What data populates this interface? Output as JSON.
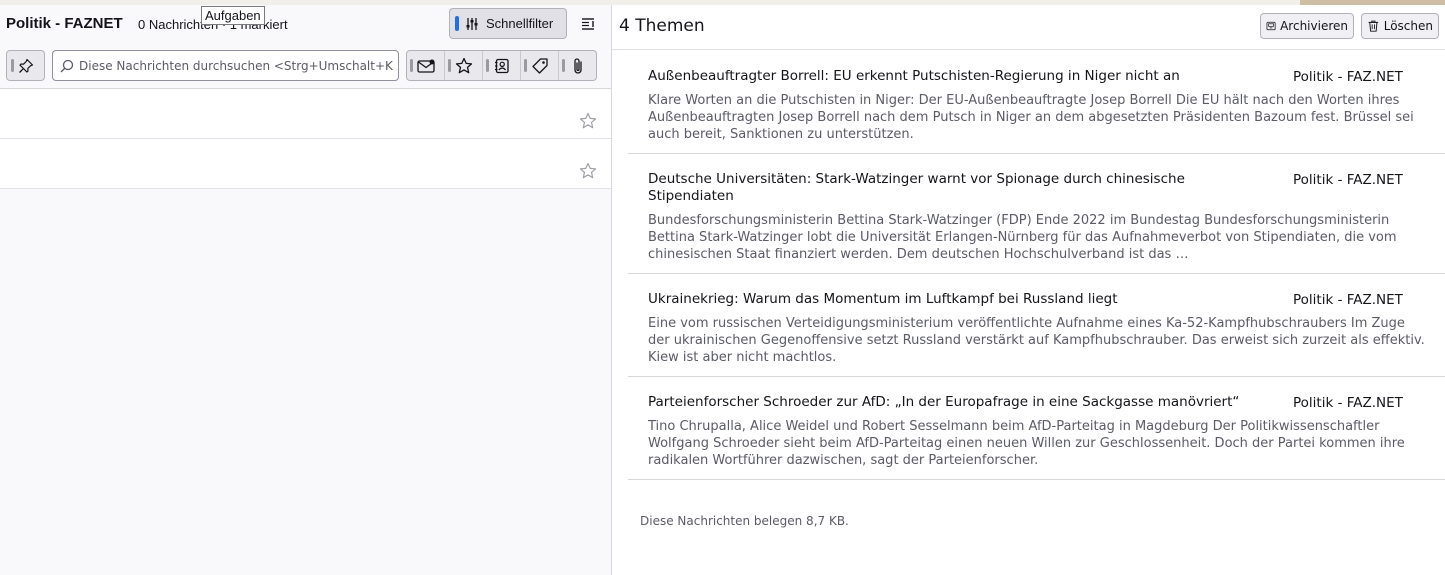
{
  "message_list": {
    "folder_name": "Politik - FAZNET",
    "count_text": "0 Nachrichten · 1 markiert",
    "tooltip": "Aufgaben",
    "quick_filter_label": "Schnellfilter",
    "search_placeholder": "Diese Nachrichten durchsuchen <Strg+Umschalt+K>",
    "filter_buttons": [
      "pin",
      "unread",
      "starred",
      "contact",
      "tags",
      "attachment"
    ],
    "rows": [
      {
        "starred": false
      },
      {
        "starred": false
      }
    ]
  },
  "summary": {
    "title": "4 Themen",
    "archive_label": "Archivieren",
    "delete_label": "Löschen",
    "topics": [
      {
        "title": "Außenbeauftragter Borrell: EU erkennt Putschisten-Regierung in Niger nicht an",
        "source": "Politik - FAZ.NET",
        "summary": "Klare Worten an die Putschisten in Niger: Der EU-Außenbeauftragte Josep Borrell Die EU hält nach den Worten ihres Außenbeauftragten Josep Borrell nach dem Putsch in Niger an dem abgesetzten Präsidenten Bazoum fest. Brüssel sei auch bereit, Sanktionen zu unterstützen."
      },
      {
        "title": "Deutsche Universitäten: Stark-Watzinger warnt vor Spionage durch chinesische Stipendiaten",
        "source": "Politik - FAZ.NET",
        "summary": "Bundesforschungsministerin Bettina Stark-Watzinger (FDP) Ende 2022 im Bundestag Bundesforschungsministerin Bettina Stark-Watzinger lobt die Universität Erlangen-Nürnberg für das Aufnahmeverbot von Stipendiaten, die vom chinesischen Staat finanziert werden. Dem deutschen Hochschulverband ist das …"
      },
      {
        "title": "Ukrainekrieg: Warum das Momentum im Luftkampf bei Russland liegt",
        "source": "Politik - FAZ.NET",
        "summary": "Eine vom russischen Verteidigungsministerium veröffentlichte Aufnahme eines Ka-52-Kampfhubschraubers Im Zuge der ukrainischen Gegenoffensive setzt Russland verstärkt auf Kampfhubschrauber. Das erweist sich zurzeit als effektiv. Kiew ist aber nicht machtlos."
      },
      {
        "title": "Parteienforscher Schroeder zur AfD: „In der Europafrage in eine Sackgasse manövriert“",
        "source": "Politik - FAZ.NET",
        "summary": "Tino Chrupalla, Alice Weidel und Robert Sesselmann beim AfD-Parteitag in Magdeburg Der Politikwissenschaftler Wolfgang Schroeder sieht beim AfD-Parteitag einen neuen Willen zur Geschlossenheit. Doch der Partei kommen ihre radikalen Wortführer dazwischen, sagt der Parteienforscher."
      }
    ],
    "footer": "Diese Nachrichten belegen 8,7 KB."
  }
}
